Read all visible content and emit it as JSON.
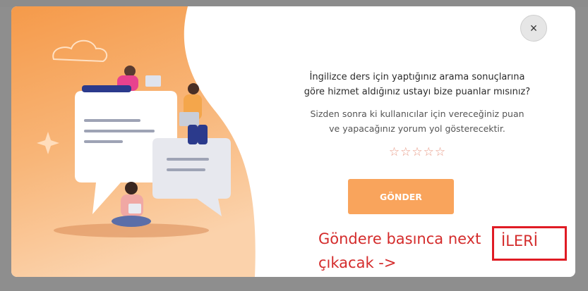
{
  "modal": {
    "close_label": "×",
    "question": "İngilizce ders için yaptığınız arama sonuçlarına\ngöre hizmet aldığınız ustayı bize puanlar mısınız?",
    "description": "Sizden sonra ki kullanıcılar için vereceğiniz puan\nve yapacağınız yorum yol gösterecektir.",
    "rating": {
      "max": 5,
      "value": 0,
      "star_glyph": "☆"
    },
    "send_button": "GÖNDER"
  },
  "annotation": {
    "note": "Göndere basınca next\nçıkacak ->",
    "next_label": "İLERİ",
    "color": "#d42c2c"
  },
  "colors": {
    "accent": "#f9a45c",
    "illustration_orange": "#f6a35c",
    "star": "#e89a86"
  }
}
